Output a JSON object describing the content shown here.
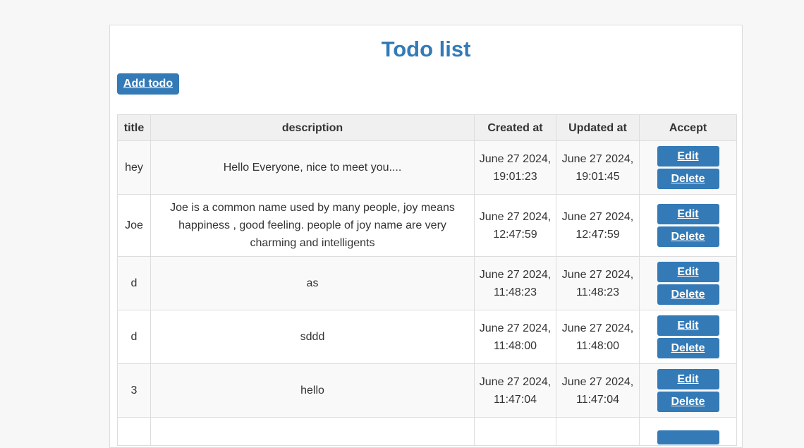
{
  "page": {
    "title": "Todo list",
    "add_button_label": "Add todo"
  },
  "colors": {
    "accent": "#337ab7",
    "page_background": "#f7f7f7",
    "header_background": "#f0f0f0"
  },
  "table": {
    "columns": [
      "title",
      "description",
      "Created at",
      "Updated at",
      "Accept"
    ],
    "edit_label": "Edit",
    "delete_label": "Delete",
    "rows": [
      {
        "title": "hey",
        "description": "Hello Everyone, nice to meet you....",
        "created_at": "June 27 2024, 19:01:23",
        "updated_at": "June 27 2024, 19:01:45"
      },
      {
        "title": "Joe",
        "description": "Joe is a common name used by many people, joy means happiness , good feeling. people of joy name are very charming and intelligents",
        "created_at": "June 27 2024, 12:47:59",
        "updated_at": "June 27 2024, 12:47:59"
      },
      {
        "title": "d",
        "description": "as",
        "created_at": "June 27 2024, 11:48:23",
        "updated_at": "June 27 2024, 11:48:23"
      },
      {
        "title": "d",
        "description": "sddd",
        "created_at": "June 27 2024, 11:48:00",
        "updated_at": "June 27 2024, 11:48:00"
      },
      {
        "title": "3",
        "description": "hello",
        "created_at": "June 27 2024, 11:47:04",
        "updated_at": "June 27 2024, 11:47:04"
      }
    ]
  }
}
